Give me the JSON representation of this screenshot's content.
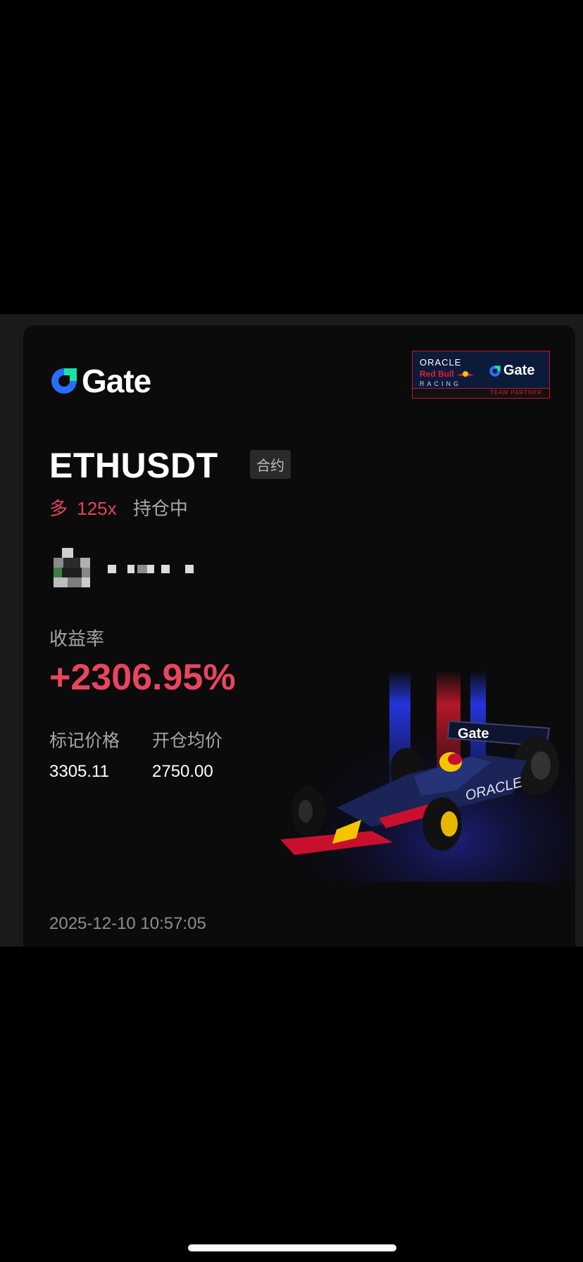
{
  "brand": {
    "name": "Gate"
  },
  "partner": {
    "oracle": "ORACLE",
    "redbull": "Red Bull",
    "racing": "RACING",
    "gate": "Gate",
    "team_partner": "TEAM PARTNER"
  },
  "position": {
    "symbol": "ETHUSDT",
    "contract_tag": "合约",
    "direction": "多",
    "leverage": "125x",
    "status": "持仓中"
  },
  "roi": {
    "label": "收益率",
    "value": "+2306.95%"
  },
  "prices": {
    "mark_label": "标记价格",
    "mark_value": "3305.11",
    "open_label": "开仓均价",
    "open_value": "2750.00"
  },
  "timestamp": "2025-12-10 10:57:05",
  "car": {
    "livery_text": "Gate",
    "sponsor_text": "ORACLE"
  },
  "colors": {
    "profit": "#e8455e",
    "brand_blue": "#2b6cf6",
    "background": "#0b0b0c"
  }
}
